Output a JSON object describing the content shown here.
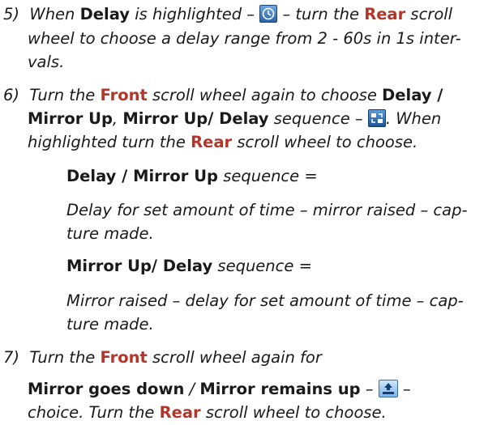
{
  "step5": {
    "num": "5)",
    "when": "When",
    "delay": "Delay",
    "is_highlighted": "is highlighted –",
    "dash": "– turn the",
    "rear": "Rear",
    "scroll": "scroll",
    "line2": "wheel to choose a delay range from 2 - 60s in 1s inter-",
    "line3": "vals."
  },
  "step6": {
    "num": "6)",
    "turn_the": "Turn the",
    "front": "Front",
    "rest1": "scroll wheel again to choose",
    "delay_slash": "Delay /",
    "mirror_up_comma": "Mirror Up",
    "comma": ",",
    "mirror_up_delay": "Mirror Up/ Delay",
    "sequence_dash": "sequence –",
    "period_when": ". When",
    "highlighted_turn": "highlighted turn the",
    "rear": "Rear",
    "to_choose": "scroll wheel to choose."
  },
  "seq1": {
    "title": "Delay / Mirror Up",
    "suffix": "sequence =",
    "desc1": "Delay for set amount of time – mirror raised – cap-",
    "desc2": "ture made."
  },
  "seq2": {
    "title": "Mirror Up/ Delay",
    "suffix": "sequence =",
    "desc1": "Mirror raised – delay for set amount of time – cap-",
    "desc2": "ture made."
  },
  "step7": {
    "num": "7)",
    "turn_the": "Turn the",
    "front": "Front",
    "rest1": "scroll wheel again for",
    "mirror_down": "Mirror goes down",
    "slash": " / ",
    "mirror_remains": "Mirror remains up",
    "dash": "–",
    "dash2": "–",
    "choice": "choice. Turn the",
    "rear": "Rear",
    "to_choose": "scroll wheel to choose."
  },
  "icons": [
    "clock-icon",
    "sequence-icon",
    "mirror-up-icon"
  ],
  "colors": {
    "accent": "#b3362b",
    "text": "#1a1a1a",
    "icon_blue": "#2a63a8"
  }
}
